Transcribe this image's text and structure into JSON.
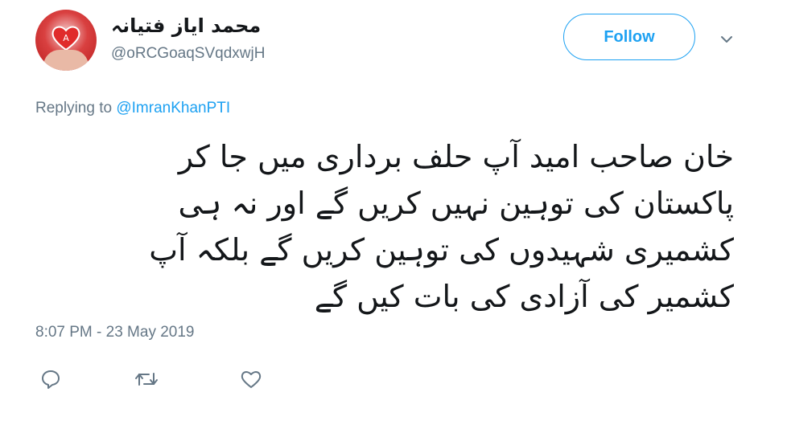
{
  "author": {
    "display_name": "محمد اياز فتيانہ",
    "username": "@oRCGoaqSVqdxwjH",
    "avatar_icon": "heart-in-hands-avatar"
  },
  "follow_button": {
    "label": "Follow"
  },
  "menu_icon": "chevron-down-icon",
  "reply_context": {
    "prefix": "Replying to ",
    "mention": "@ImranKhanPTI"
  },
  "tweet": {
    "lines": [
      "خان صاحب امید آپ حلف برداری میں جا کر",
      "پاکستان کی توہین نہیں کریں گے اور نہ ہی",
      "کشمیری شہیدوں کی توہین کریں گے  بلکہ آپ",
      "کشمیر کی آزادی کی بات کیں گے"
    ],
    "timestamp": "8:07 PM - 23 May 2019"
  },
  "actions": [
    "reply-icon",
    "retweet-icon",
    "like-icon"
  ],
  "colors": {
    "accent": "#1da1f2",
    "secondary_text": "#657786",
    "primary_text": "#14171a"
  }
}
